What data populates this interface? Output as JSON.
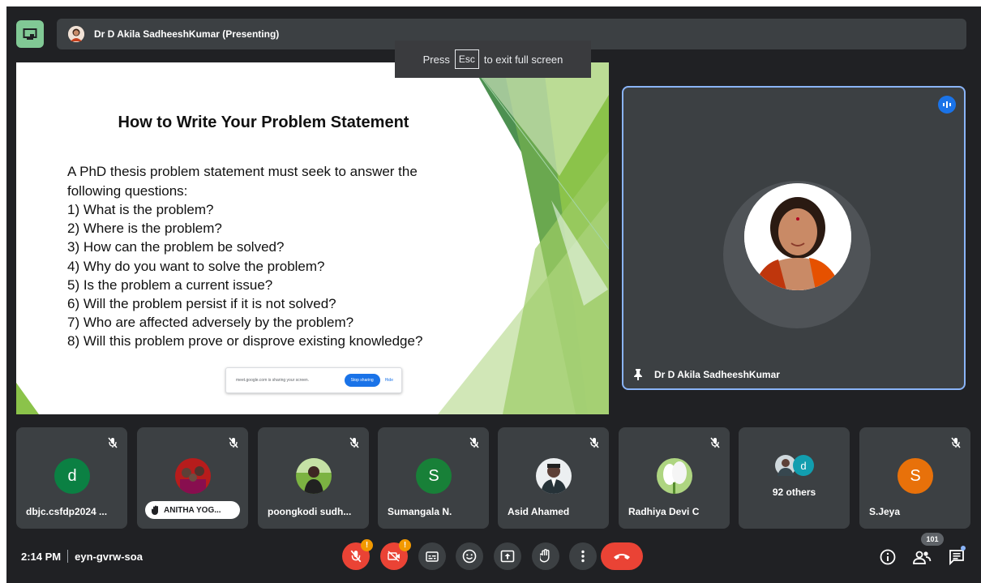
{
  "top_bar": {
    "presenter_title": "Dr D Akila SadheeshKumar (Presenting)"
  },
  "esc_toast": {
    "before": "Press",
    "key": "Esc",
    "after": "to exit full screen"
  },
  "slide": {
    "title": "How to Write Your Problem Statement",
    "intro": "A PhD thesis problem statement must seek to answer the following questions:",
    "questions": [
      "1)  What is the problem?",
      "2)  Where is the problem?",
      "3)  How can the problem be solved?",
      "4)  Why do you want to solve the problem?",
      "5)  Is the problem a current issue?",
      "6)  Will the problem persist if it is not solved?",
      "7)  Who are affected adversely by the problem?",
      "8)  Will this problem prove or disprove existing knowledge?"
    ],
    "share_bar": {
      "text": "meet.google.com is sharing your screen.",
      "stop_label": "Stop sharing",
      "hide_label": "Hide"
    }
  },
  "speaker": {
    "name": "Dr D Akila SadheeshKumar"
  },
  "participants": [
    {
      "name": "dbjc.csfdp2024 ...",
      "initial": "d",
      "color": "#0b8043"
    },
    {
      "name": "ANITHA YOG..."
    },
    {
      "name": "poongkodi sudh..."
    },
    {
      "name": "Sumangala N.",
      "initial": "S",
      "color": "#188038"
    },
    {
      "name": "Asid Ahamed"
    },
    {
      "name": "Radhiya Devi C"
    },
    {
      "name": "92 others",
      "initial": "d",
      "color": "#129eaf"
    },
    {
      "name": "S.Jeya",
      "initial": "S",
      "color": "#e8710a"
    }
  ],
  "bottom_bar": {
    "time": "2:14 PM",
    "meeting_code": "eyn-gvrw-soa",
    "warning_mark": "!",
    "participant_count": "101"
  },
  "colors": {
    "background": "#202124",
    "tile": "#3c4043",
    "end_call": "#ea4335",
    "accent": "#8ab4f8",
    "slide_green": "#8bc34a"
  }
}
